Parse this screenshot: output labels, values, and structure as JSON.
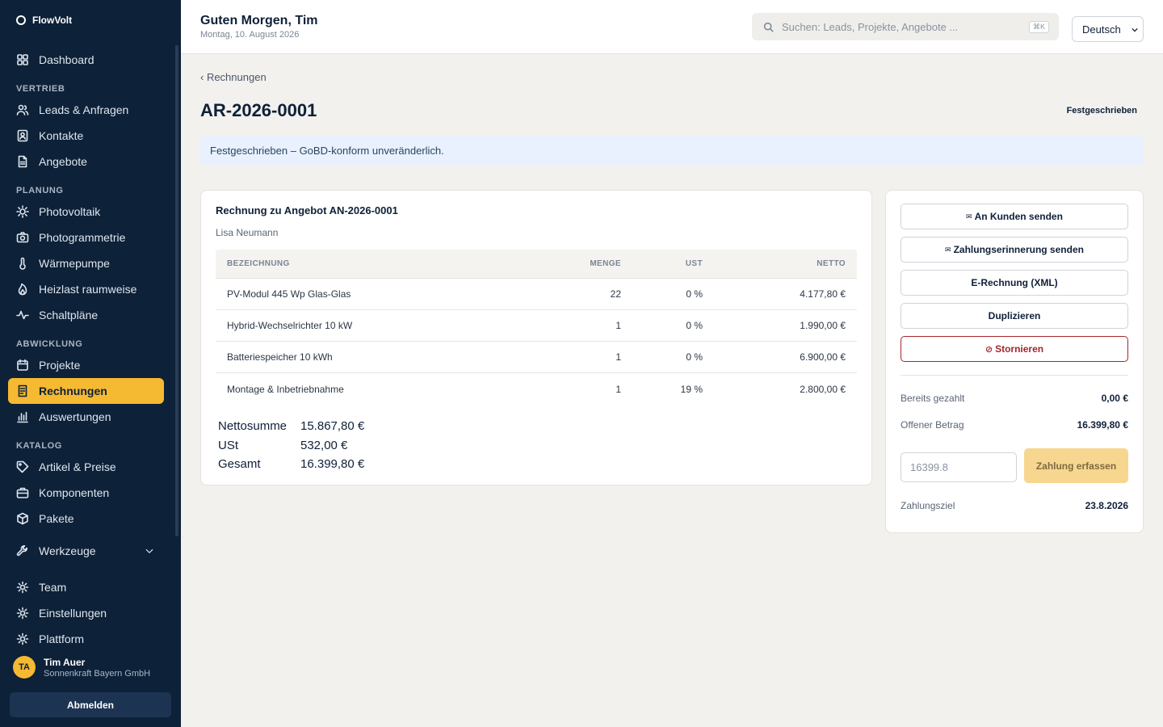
{
  "brand": {
    "name": "FlowVolt"
  },
  "sidebar": {
    "top": [
      {
        "label": "Dashboard",
        "icon": "grid-icon"
      }
    ],
    "sections": {
      "vertrieb": "VERTRIEB",
      "planung": "PLANUNG",
      "abwicklung": "ABWICKLUNG",
      "katalog": "KATALOG"
    },
    "items": {
      "leads": "Leads & Anfragen",
      "kontakte": "Kontakte",
      "angebote": "Angebote",
      "photovoltaik": "Photovoltaik",
      "photogrammetrie": "Photogrammetrie",
      "waermepumpe": "Wärmepumpe",
      "heizlast": "Heizlast raumweise",
      "schaltplaene": "Schaltpläne",
      "projekte": "Projekte",
      "rechnungen": "Rechnungen",
      "auswertungen": "Auswertungen",
      "artikel": "Artikel & Preise",
      "komponenten": "Komponenten",
      "pakete": "Pakete",
      "werkzeuge": "Werkzeuge",
      "team": "Team",
      "einstellungen": "Einstellungen",
      "plattform": "Plattform"
    },
    "active": "Rechnungen",
    "user": {
      "initials": "TA",
      "name": "Tim Auer",
      "org": "Sonnenkraft Bayern GmbH"
    },
    "logout_label": "Abmelden"
  },
  "header": {
    "greeting": "Guten Morgen, Tim",
    "date": "Montag, 10. August 2026",
    "search_placeholder": "Suchen: Leads, Projekte, Angebote ...",
    "search_shortcut": "⌘K",
    "language": "Deutsch"
  },
  "page": {
    "breadcrumb": "‹ Rechnungen",
    "title": "AR-2026-0001",
    "status": "Festgeschrieben",
    "notice": "Festgeschrieben – GoBD-konform unveränderlich."
  },
  "invoice": {
    "title": "Rechnung zu Angebot AN-2026-0001",
    "customer": "Lisa Neumann",
    "columns": {
      "name": "BEZEICHNUNG",
      "qty": "MENGE",
      "vat": "UST",
      "net": "NETTO"
    },
    "rows": [
      {
        "name": "PV-Modul 445 Wp Glas-Glas",
        "qty": "22",
        "vat": "0 %",
        "net": "4.177,80 €"
      },
      {
        "name": "Hybrid-Wechselrichter 10 kW",
        "qty": "1",
        "vat": "0 %",
        "net": "1.990,00 €"
      },
      {
        "name": "Batteriespeicher 10 kWh",
        "qty": "1",
        "vat": "0 %",
        "net": "6.900,00 €"
      },
      {
        "name": "Montage & Inbetriebnahme",
        "qty": "1",
        "vat": "19 %",
        "net": "2.800,00 €"
      }
    ],
    "totals": {
      "net_label": "Nettosumme",
      "net_value": "15.867,80 €",
      "vat_label": "USt",
      "vat_value": "532,00 €",
      "gross_label": "Gesamt",
      "gross_value": "16.399,80 €"
    }
  },
  "actions": {
    "send_customer": "An Kunden senden",
    "send_reminder": "Zahlungserinnerung senden",
    "e_invoice": "E-Rechnung (XML)",
    "duplicate": "Duplizieren",
    "cancel": "Stornieren",
    "mail_glyph": "✉",
    "cancel_glyph": "⊘"
  },
  "payment": {
    "paid_label": "Bereits gezahlt",
    "paid_value": "0,00 €",
    "open_label": "Offener Betrag",
    "open_value": "16.399,80 €",
    "input_value": "16399.8",
    "submit_label": "Zahlung erfassen",
    "due_label": "Zahlungsziel",
    "due_value": "23.8.2026"
  },
  "colors": {
    "sidebar": "#0d2138",
    "accent": "#f5b932",
    "danger": "#a4262c",
    "notice": "#e8f1fd"
  }
}
